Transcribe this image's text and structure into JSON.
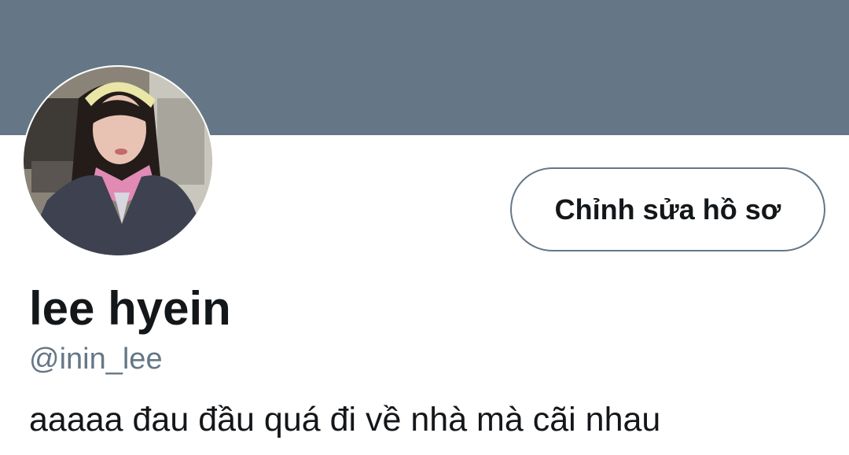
{
  "profile": {
    "display_name": "lee hyein",
    "handle": "@inin_lee",
    "bio": "aaaaa đau đầu quá đi về nhà mà cãi nhau",
    "edit_profile_label": "Chỉnh sửa hồ sơ",
    "avatar_icon": "profile-photo"
  },
  "colors": {
    "banner": "#657786",
    "primary_text": "#14171a",
    "secondary_text": "#657786",
    "button_border": "#657786",
    "background": "#ffffff"
  }
}
